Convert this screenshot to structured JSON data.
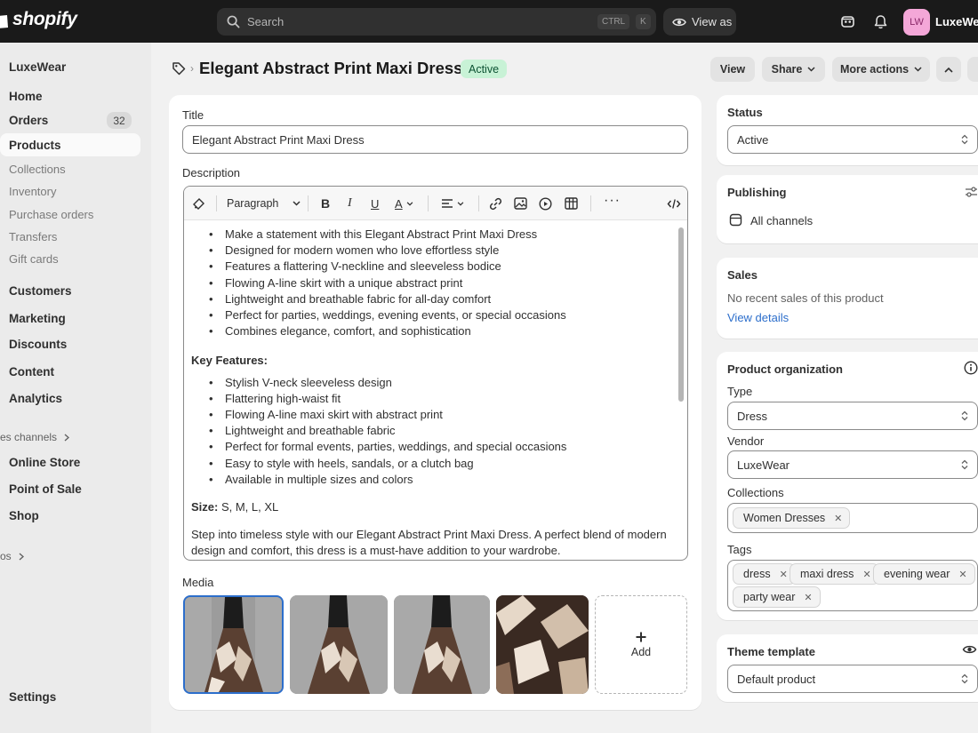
{
  "topbar": {
    "logo_text": "shopify",
    "search_placeholder": "Search",
    "kbd_ctrl": "CTRL",
    "kbd_k": "K",
    "view_as": "View as",
    "avatar_initials": "LW",
    "store_name": "LuxeWear"
  },
  "sidebar": {
    "store": "LuxeWear",
    "items": [
      {
        "label": "Home"
      },
      {
        "label": "Orders",
        "badge": "32"
      },
      {
        "label": "Products"
      },
      {
        "label": "Collections"
      },
      {
        "label": "Inventory"
      },
      {
        "label": "Purchase orders"
      },
      {
        "label": "Transfers"
      },
      {
        "label": "Gift cards"
      },
      {
        "label": "Customers"
      },
      {
        "label": "Marketing"
      },
      {
        "label": "Discounts"
      },
      {
        "label": "Content"
      },
      {
        "label": "Analytics"
      }
    ],
    "sales_channels_label": "es channels",
    "channels": [
      {
        "label": "Online Store"
      },
      {
        "label": "Point of Sale"
      },
      {
        "label": "Shop"
      }
    ],
    "apps_label": "os",
    "settings": "Settings"
  },
  "header": {
    "title": "Elegant Abstract Print Maxi Dress",
    "status_badge": "Active",
    "view_button": "View",
    "share_button": "Share",
    "more_actions_button": "More actions"
  },
  "main": {
    "title_label": "Title",
    "title_value": "Elegant Abstract Print Maxi Dress",
    "description_label": "Description",
    "toolbar_paragraph": "Paragraph",
    "bullets_1": [
      "Make a statement with this Elegant Abstract Print Maxi Dress",
      "Designed for modern women who love effortless style",
      "Features a flattering V-neckline and sleeveless bodice",
      "Flowing A-line skirt with a unique abstract print",
      "Lightweight and breathable fabric for all-day comfort",
      "Perfect for parties, weddings, evening events, or special occasions",
      "Combines elegance, comfort, and sophistication"
    ],
    "key_features_heading": "Key Features:",
    "bullets_2": [
      "Stylish V-neck sleeveless design",
      "Flattering high-waist fit",
      "Flowing A-line maxi skirt with abstract print",
      "Lightweight and breathable fabric",
      "Perfect for formal events, parties, weddings, and special occasions",
      "Easy to style with heels, sandals, or a clutch bag",
      "Available in multiple sizes and colors"
    ],
    "size_label": "Size:",
    "size_value": " S, M, L, XL",
    "closing_paragraph": "Step into timeless style with our Elegant Abstract Print Maxi Dress. A perfect blend of modern design and comfort, this dress is a must-have addition to your wardrobe.",
    "media_label": "Media",
    "add_media": "Add"
  },
  "right": {
    "status_title": "Status",
    "status_value": "Active",
    "publishing_title": "Publishing",
    "publishing_channels": "All channels",
    "sales_title": "Sales",
    "sales_text": "No recent sales of this product",
    "view_details": "View details",
    "org_title": "Product organization",
    "type_label": "Type",
    "type_value": "Dress",
    "vendor_label": "Vendor",
    "vendor_value": "LuxeWear",
    "collections_label": "Collections",
    "collections": [
      "Women Dresses"
    ],
    "tags_label": "Tags",
    "tags": [
      "dress",
      "maxi dress",
      "evening wear",
      "party wear"
    ],
    "theme_title": "Theme template",
    "theme_value": "Default product"
  },
  "colors": {
    "topbar": "#1a1a1a",
    "active_badge_bg": "#c8f2d6",
    "active_badge_text": "#0c5132",
    "link": "#2c6ecb",
    "avatar_bg": "#f4a7d8"
  }
}
